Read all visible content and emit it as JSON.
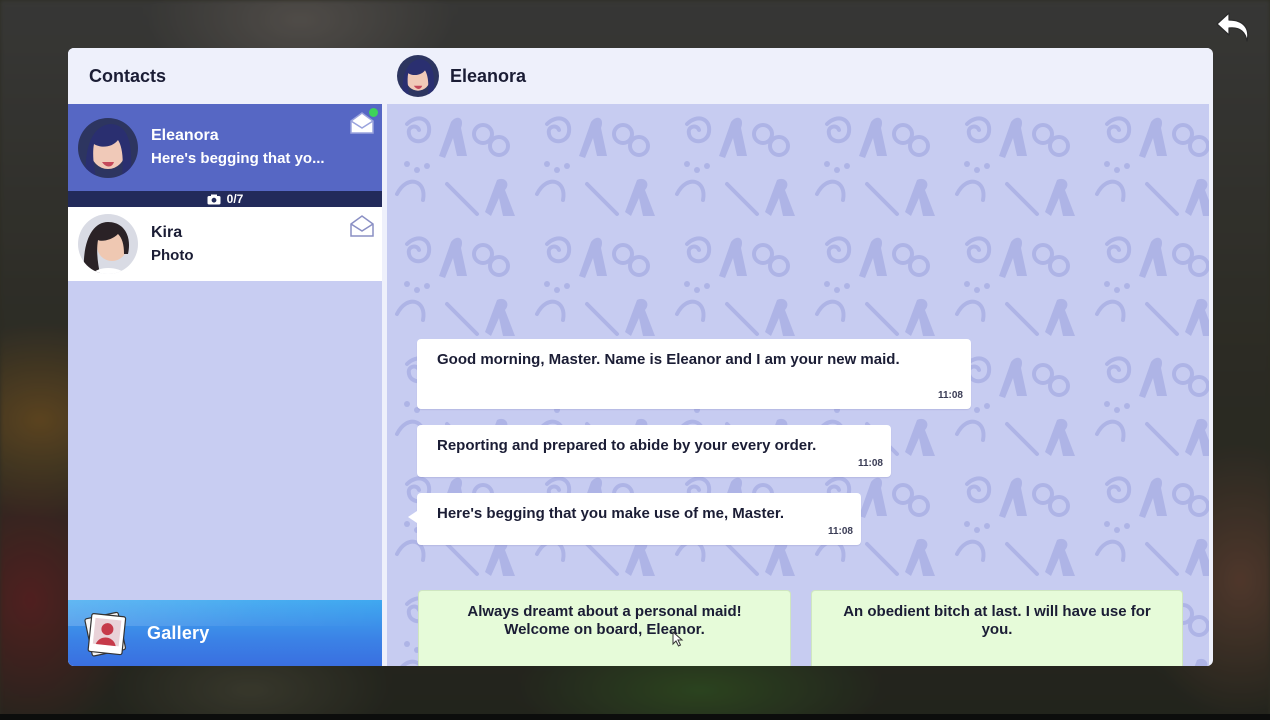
{
  "contacts_panel": {
    "title": "Contacts",
    "contacts": [
      {
        "name": "Eleanora",
        "preview": "Here's begging that yo...",
        "photos": "0/7",
        "active": true,
        "online": true
      },
      {
        "name": "Kira",
        "preview": "Photo",
        "active": false,
        "online": false
      }
    ],
    "gallery_label": "Gallery"
  },
  "chat": {
    "contact_name": "Eleanora",
    "messages": [
      {
        "text": "Good morning, Master. Name is Eleanor and I am your new maid.",
        "time": "11:08"
      },
      {
        "text": "Reporting and prepared to abide by your every order.",
        "time": "11:08"
      },
      {
        "text": "Here's begging that you make use of me, Master.",
        "time": "11:08"
      }
    ],
    "choices": [
      {
        "text": "Always dreamt about a personal maid! Welcome on board, Eleanor."
      },
      {
        "text": "An obedient bitch at last. I will have use for you."
      }
    ]
  },
  "colors": {
    "active_contact": "#5667c4",
    "chat_background": "#c7ccf1",
    "choice_background": "#e6fbd9",
    "gallery_button": "#3b82e6"
  },
  "icons": [
    "back-arrow-icon",
    "envelope-icon",
    "camera-icon",
    "gallery-photos-icon"
  ]
}
